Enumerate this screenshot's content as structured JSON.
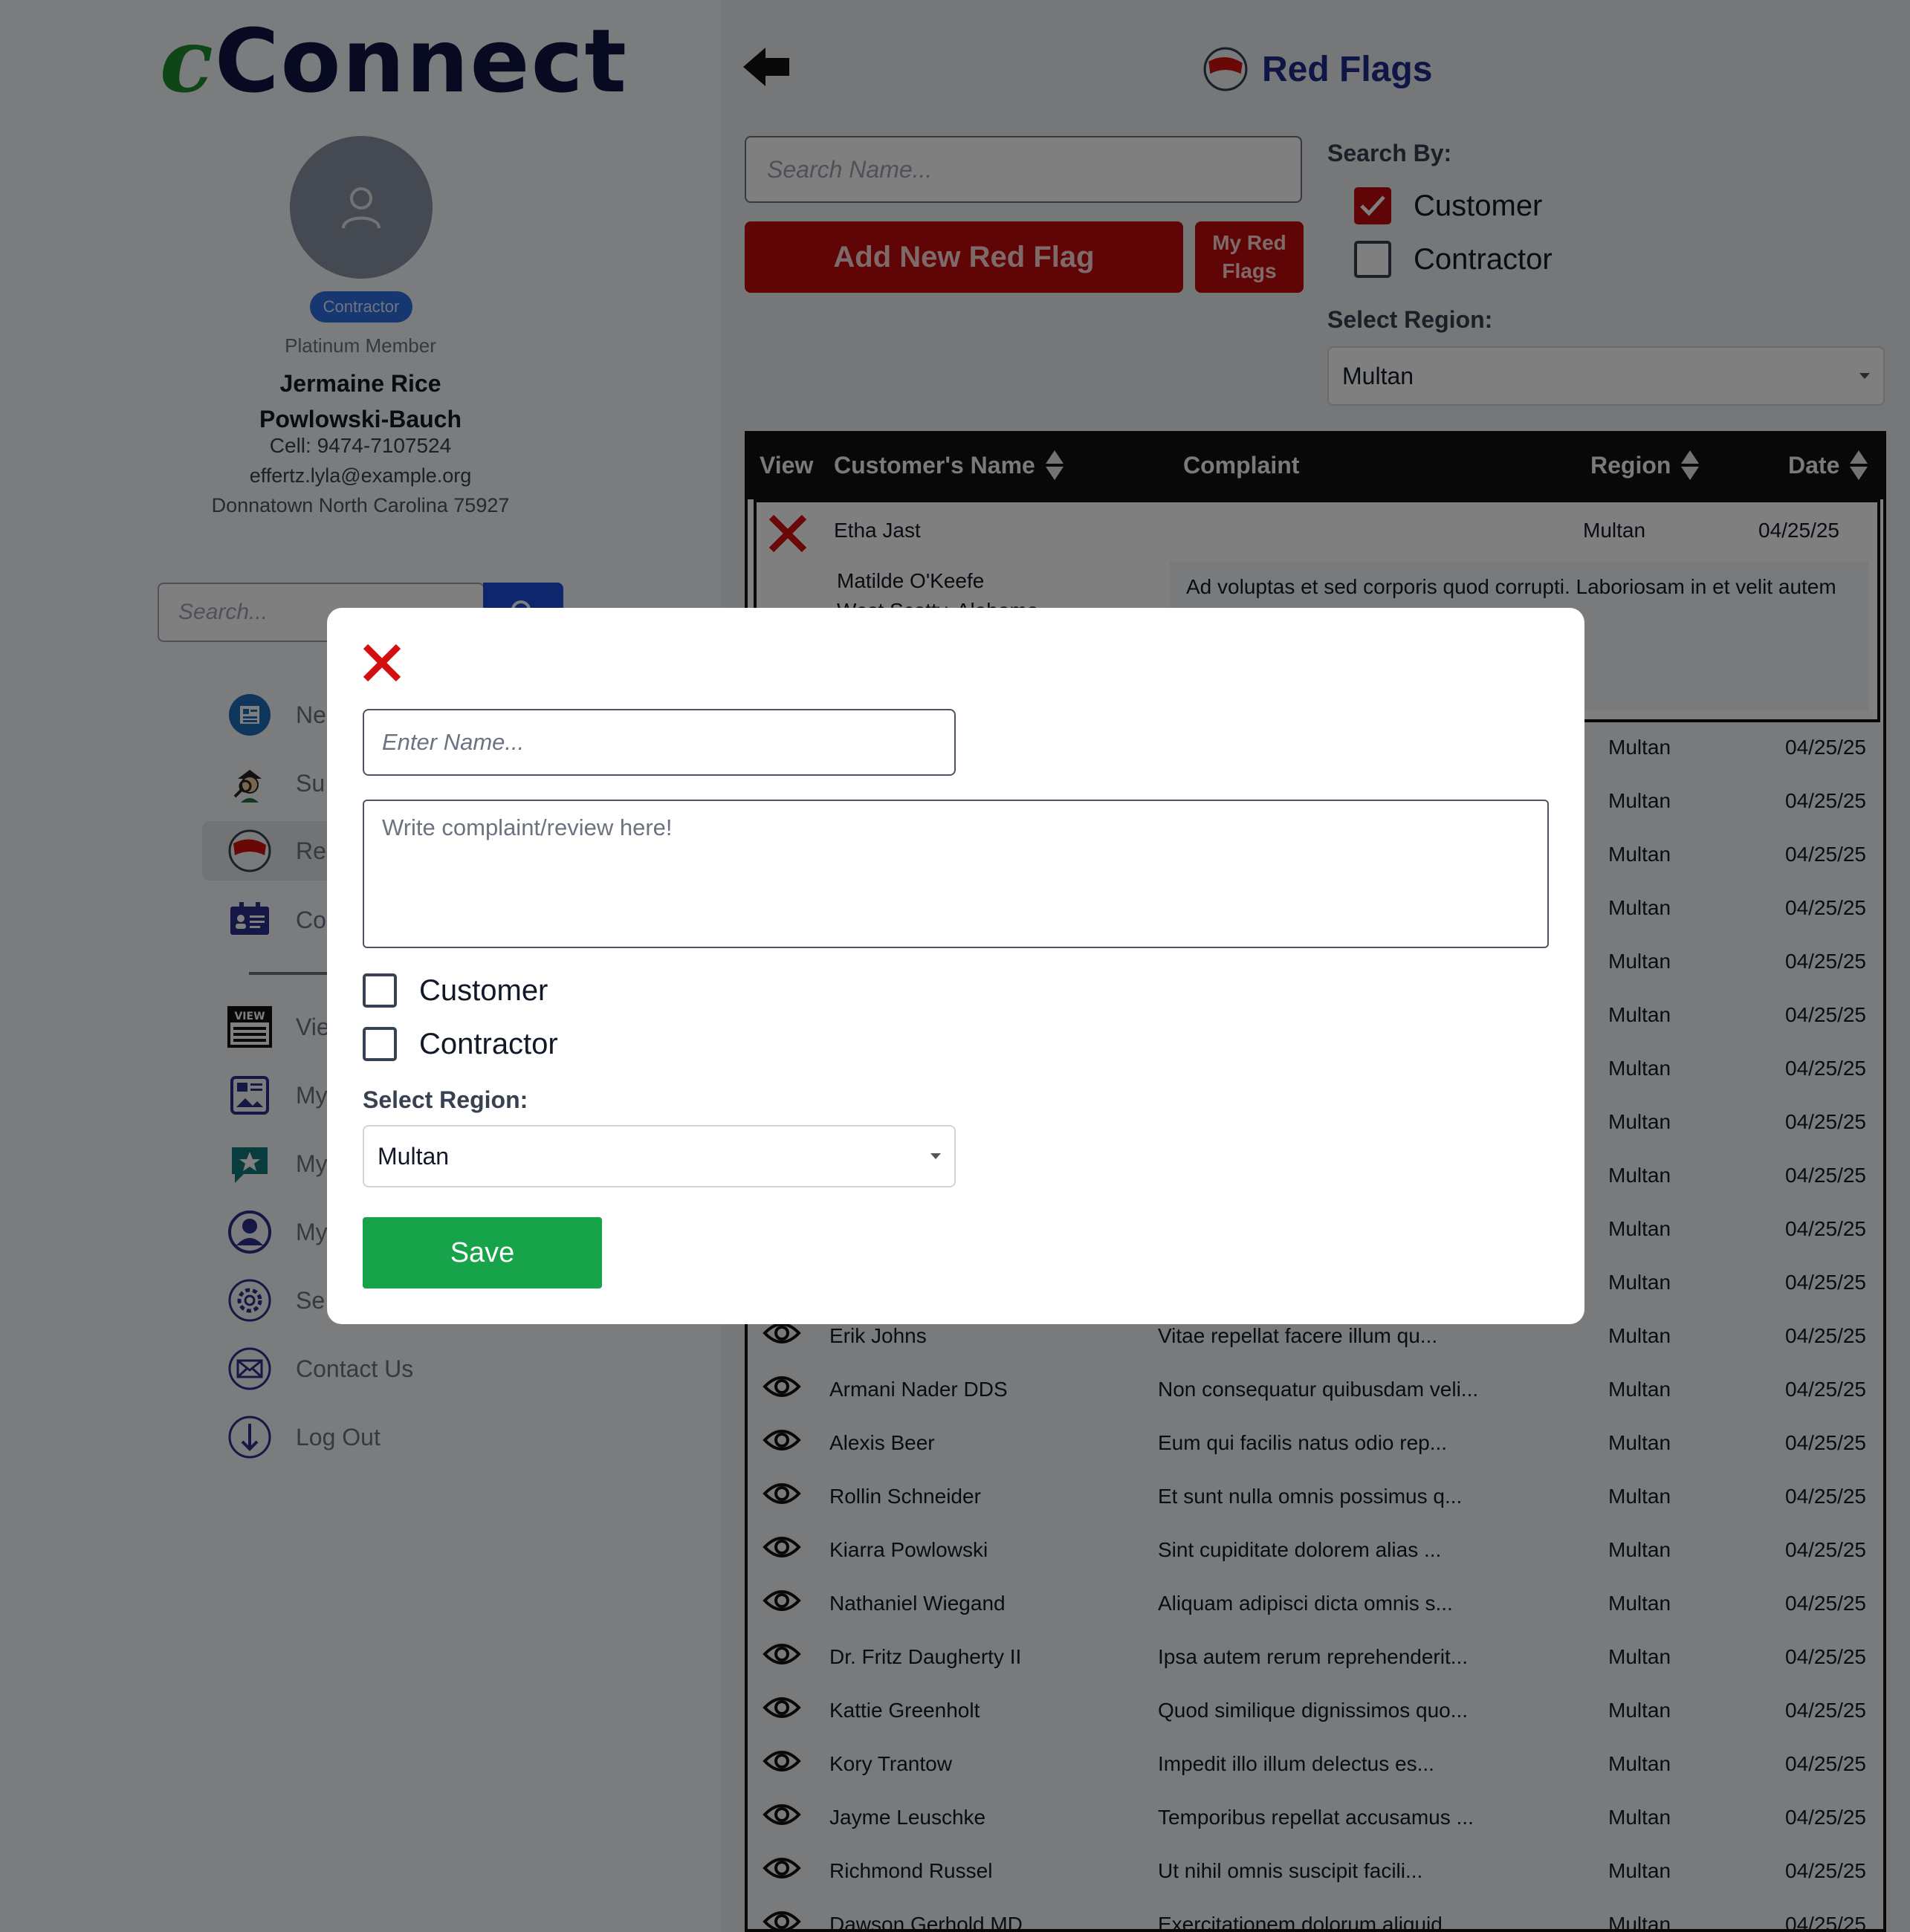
{
  "sidebar": {
    "logo_c": "c",
    "logo_rest": "Connect",
    "role_badge": "Contractor",
    "membership": "Platinum Member",
    "name_line1": "Jermaine Rice",
    "name_line2": "Powlowski-Bauch",
    "cell": "Cell: 9474-7107524",
    "email": "effertz.lyla@example.org",
    "address": "Donnatown North Carolina 75927",
    "search_placeholder": "Search...",
    "nav": [
      {
        "label": "Ne",
        "icon": "newspaper-icon"
      },
      {
        "label": "Su",
        "icon": "detective-icon"
      },
      {
        "label": "Re",
        "icon": "red-flag-icon"
      },
      {
        "label": "Co",
        "icon": "id-card-icon"
      },
      {
        "label": "Vie",
        "icon": "view-icon"
      },
      {
        "label": "My",
        "icon": "gallery-icon"
      },
      {
        "label": "My",
        "icon": "star-chat-icon"
      },
      {
        "label": "My",
        "icon": "user-icon"
      },
      {
        "label": "Se",
        "icon": "gear-icon"
      },
      {
        "label": "Contact Us",
        "icon": "mail-icon"
      },
      {
        "label": "Log Out",
        "icon": "logout-icon"
      }
    ]
  },
  "header": {
    "title": "Red Flags"
  },
  "search": {
    "placeholder": "Search Name..."
  },
  "actions": {
    "add": "Add New Red Flag",
    "my_line1": "My Red",
    "my_line2": "Flags"
  },
  "filters": {
    "search_by_label": "Search By:",
    "customer": "Customer",
    "contractor": "Contractor",
    "customer_checked": true,
    "contractor_checked": false,
    "region_label": "Select Region:",
    "region_value": "Multan"
  },
  "table": {
    "headers": {
      "view": "View",
      "name": "Customer's Name",
      "complaint": "Complaint",
      "region": "Region",
      "date": "Date"
    },
    "expanded": {
      "name": "Etha Jast",
      "region": "Multan",
      "date": "04/25/25",
      "person_line1": "Matilde O'Keefe",
      "person_line2": "West Scotty, Alabama",
      "complaint": "Ad voluptas et sed corporis quod corrupti. Laboriosam in et velit autem numquam voluptas."
    },
    "rows": [
      {
        "name": "",
        "complaint": "",
        "region": "Multan",
        "date": "04/25/25"
      },
      {
        "name": "",
        "complaint": "",
        "region": "Multan",
        "date": "04/25/25"
      },
      {
        "name": "",
        "complaint": "",
        "region": "Multan",
        "date": "04/25/25"
      },
      {
        "name": "",
        "complaint": "",
        "region": "Multan",
        "date": "04/25/25"
      },
      {
        "name": "",
        "complaint": "",
        "region": "Multan",
        "date": "04/25/25"
      },
      {
        "name": "",
        "complaint": "",
        "region": "Multan",
        "date": "04/25/25"
      },
      {
        "name": "",
        "complaint": "",
        "region": "Multan",
        "date": "04/25/25"
      },
      {
        "name": "",
        "complaint": "",
        "region": "Multan",
        "date": "04/25/25"
      },
      {
        "name": "",
        "complaint": "",
        "region": "Multan",
        "date": "04/25/25"
      },
      {
        "name": "",
        "complaint": "",
        "region": "Multan",
        "date": "04/25/25"
      },
      {
        "name": "",
        "complaint": "",
        "region": "Multan",
        "date": "04/25/25"
      },
      {
        "name": "Erik Johns",
        "complaint": "Vitae repellat facere illum qu...",
        "region": "Multan",
        "date": "04/25/25"
      },
      {
        "name": "Armani Nader DDS",
        "complaint": "Non consequatur quibusdam veli...",
        "region": "Multan",
        "date": "04/25/25"
      },
      {
        "name": "Alexis Beer",
        "complaint": "Eum qui facilis natus odio rep...",
        "region": "Multan",
        "date": "04/25/25"
      },
      {
        "name": "Rollin Schneider",
        "complaint": "Et sunt nulla omnis possimus q...",
        "region": "Multan",
        "date": "04/25/25"
      },
      {
        "name": "Kiarra Powlowski",
        "complaint": "Sint cupiditate dolorem alias ...",
        "region": "Multan",
        "date": "04/25/25"
      },
      {
        "name": "Nathaniel Wiegand",
        "complaint": "Aliquam adipisci dicta omnis s...",
        "region": "Multan",
        "date": "04/25/25"
      },
      {
        "name": "Dr. Fritz Daugherty II",
        "complaint": "Ipsa autem rerum reprehenderit...",
        "region": "Multan",
        "date": "04/25/25"
      },
      {
        "name": "Kattie Greenholt",
        "complaint": "Quod similique dignissimos quo...",
        "region": "Multan",
        "date": "04/25/25"
      },
      {
        "name": "Kory Trantow",
        "complaint": "Impedit illo illum delectus es...",
        "region": "Multan",
        "date": "04/25/25"
      },
      {
        "name": "Jayme Leuschke",
        "complaint": "Temporibus repellat accusamus ...",
        "region": "Multan",
        "date": "04/25/25"
      },
      {
        "name": "Richmond Russel",
        "complaint": "Ut nihil omnis suscipit facili...",
        "region": "Multan",
        "date": "04/25/25"
      },
      {
        "name": "Dawson Gerhold MD",
        "complaint": "Exercitationem dolorum aliquid...",
        "region": "Multan",
        "date": "04/25/25"
      }
    ]
  },
  "modal": {
    "name_placeholder": "Enter Name...",
    "complaint_placeholder": "Write complaint/review here!",
    "customer": "Customer",
    "contractor": "Contractor",
    "region_label": "Select Region:",
    "region_value": "Multan",
    "save": "Save"
  },
  "colors": {
    "brand_navy": "#101545",
    "logo_green": "#1e8c2e",
    "flag_red": "#c10a0a",
    "save_green": "#16a34a",
    "header_black": "#111111"
  }
}
